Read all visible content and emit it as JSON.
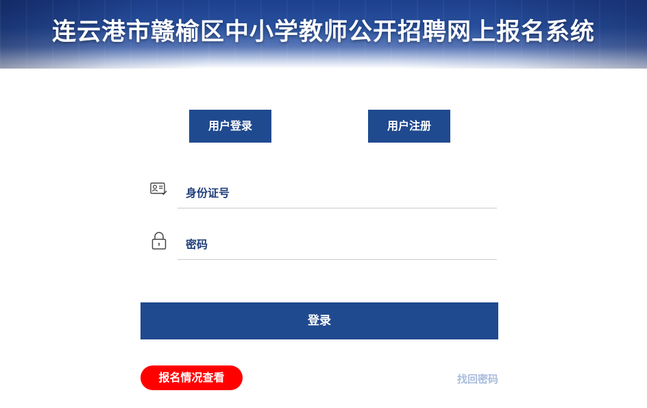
{
  "header": {
    "title": "连云港市赣榆区中小学教师公开招聘网上报名系统"
  },
  "tabs": [
    {
      "label": "用户登录"
    },
    {
      "label": "用户注册"
    }
  ],
  "form": {
    "id_field": {
      "placeholder": "身份证号",
      "icon": "id-card-icon",
      "value": ""
    },
    "password_field": {
      "placeholder": "密码",
      "icon": "lock-icon",
      "value": ""
    },
    "submit_label": "登录"
  },
  "footer": {
    "status_button_label": "报名情况查看",
    "forgot_password_label": "找回密码"
  },
  "colors": {
    "primary": "#204a8f",
    "accent_red": "#ff0000",
    "link_muted": "#a9bcdc",
    "label_text": "#1f3d7a"
  }
}
